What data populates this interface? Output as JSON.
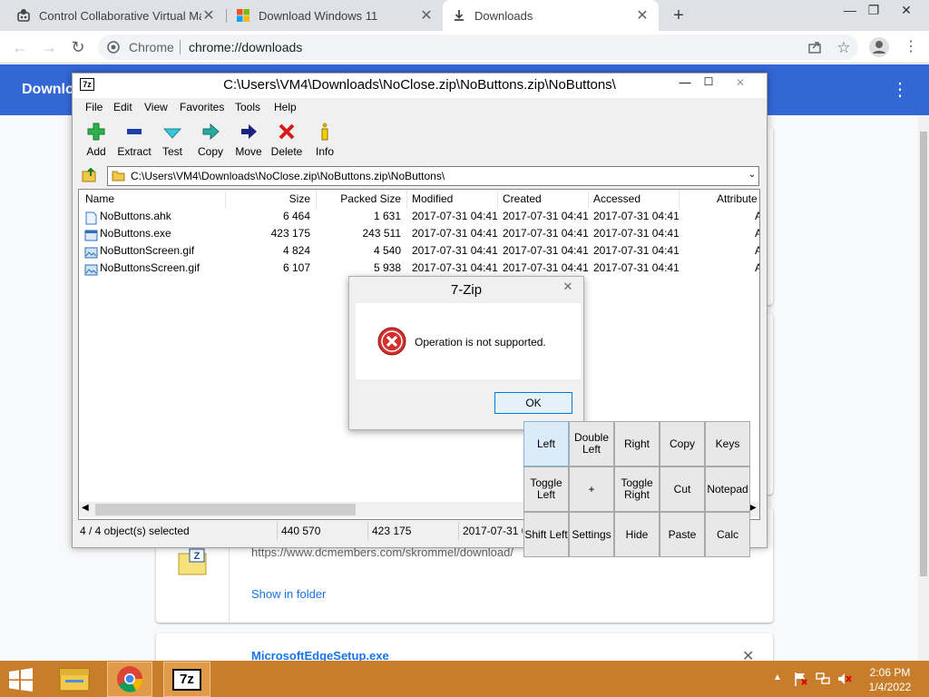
{
  "browser": {
    "tabs": [
      {
        "title": "Control Collaborative Virtual Ma",
        "icon": "vm-icon"
      },
      {
        "title": "Download Windows 11",
        "icon": "windows-logo-icon"
      },
      {
        "title": "Downloads",
        "icon": "download-icon",
        "active": true
      }
    ],
    "new_tab_label": "+",
    "window_controls": {
      "minimize": "—",
      "restore": "❐",
      "close": "✕"
    },
    "omnibox": {
      "site_label": "Chrome",
      "url": "chrome://downloads"
    }
  },
  "downloads_page": {
    "title": "Downlo",
    "header_color": "#3367d6",
    "card1": {
      "url": "https://www.dcmembers.com/skrommel/download/",
      "show_in_folder": "Show in folder"
    },
    "card2": {
      "file_name": "MicrosoftEdgeSetup.exe",
      "close": "✕"
    }
  },
  "sevenzip": {
    "title": "C:\\Users\\VM4\\Downloads\\NoClose.zip\\NoButtons.zip\\NoButtons\\",
    "menu": [
      "File",
      "Edit",
      "View",
      "Favorites",
      "Tools",
      "Help"
    ],
    "toolbar": [
      {
        "label": "Add",
        "icon": "add-plus-icon"
      },
      {
        "label": "Extract",
        "icon": "extract-minus-icon"
      },
      {
        "label": "Test",
        "icon": "test-check-icon"
      },
      {
        "label": "Copy",
        "icon": "copy-arrow-icon"
      },
      {
        "label": "Move",
        "icon": "move-arrow-icon"
      },
      {
        "label": "Delete",
        "icon": "delete-x-icon"
      },
      {
        "label": "Info",
        "icon": "info-icon"
      }
    ],
    "address": "C:\\Users\\VM4\\Downloads\\NoClose.zip\\NoButtons.zip\\NoButtons\\",
    "columns": [
      "Name",
      "Size",
      "Packed Size",
      "Modified",
      "Created",
      "Accessed",
      "Attribute"
    ],
    "files": [
      {
        "name": "NoButtons.ahk",
        "size": "6 464",
        "packed": "1 631",
        "modified": "2017-07-31 04:41",
        "created": "2017-07-31 04:41",
        "accessed": "2017-07-31 04:41",
        "attr": "A",
        "icon": "text-file-icon"
      },
      {
        "name": "NoButtons.exe",
        "size": "423 175",
        "packed": "243 511",
        "modified": "2017-07-31 04:41",
        "created": "2017-07-31 04:41",
        "accessed": "2017-07-31 04:41",
        "attr": "A",
        "icon": "exe-file-icon"
      },
      {
        "name": "NoButtonScreen.gif",
        "size": "4 824",
        "packed": "4 540",
        "modified": "2017-07-31 04:41",
        "created": "2017-07-31 04:41",
        "accessed": "2017-07-31 04:41",
        "attr": "A",
        "icon": "image-file-icon"
      },
      {
        "name": "NoButtonsScreen.gif",
        "size": "6 107",
        "packed": "5 938",
        "modified": "2017-07-31 04:41",
        "created": "2017-07-31 04:41",
        "accessed": "2017-07-31 04:41",
        "attr": "A",
        "icon": "image-file-icon"
      }
    ],
    "status": {
      "selected": "4 / 4 object(s) selected",
      "size": "440 570",
      "packed": "423 175",
      "modified": "2017-07-31 0"
    }
  },
  "dialog": {
    "title": "7-Zip",
    "message": "Operation is not supported.",
    "ok": "OK",
    "icon": "error-icon"
  },
  "keypad": [
    {
      "label": "Left",
      "highlight": true
    },
    {
      "label": "Double\nLeft"
    },
    {
      "label": "Right"
    },
    {
      "label": "Copy"
    },
    {
      "label": "Keys"
    },
    {
      "label": "Toggle\nLeft"
    },
    {
      "label": "+"
    },
    {
      "label": "Toggle\nRight"
    },
    {
      "label": "Cut"
    },
    {
      "label": "Notepad"
    },
    {
      "label": "Shift Left"
    },
    {
      "label": "Settings"
    },
    {
      "label": "Hide"
    },
    {
      "label": "Paste"
    },
    {
      "label": "Calc"
    }
  ],
  "taskbar": {
    "color": "#c87d2b",
    "apps": [
      "file-explorer-icon",
      "chrome-icon",
      "7zip-icon"
    ],
    "sevenzip_label": "7z",
    "tray": {
      "time": "2:06 PM",
      "date": "1/4/2022"
    }
  }
}
